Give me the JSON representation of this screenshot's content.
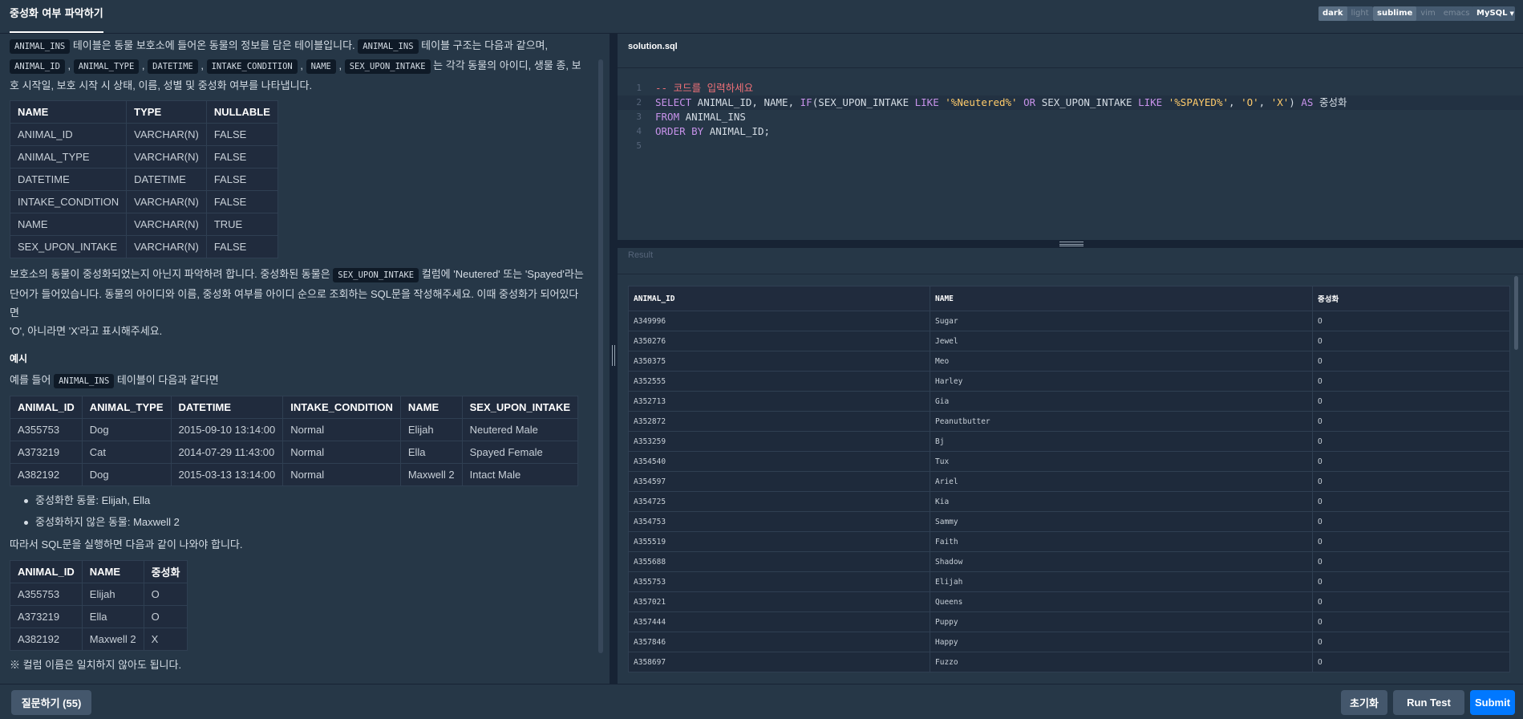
{
  "header": {
    "tab_title": "중성화 여부 파악하기",
    "theme": [
      "dark",
      "light"
    ],
    "keymap": [
      "sublime",
      "vim",
      "emacs"
    ],
    "language": "MySQL"
  },
  "problem": {
    "intro": {
      "p1_code": "ANIMAL_INS",
      "p1_text1": "테이블은 동물 보호소에 들어온 동물의 정보를 담은 테이블입니다.",
      "p1_code2": "ANIMAL_INS",
      "p1_text2": "테이블 구조는 다음과 같으며,",
      "cols": [
        "ANIMAL_ID",
        "ANIMAL_TYPE",
        "DATETIME",
        "INTAKE_CONDITION",
        "NAME",
        "SEX_UPON_INTAKE"
      ],
      "p1_text3": "는 각각 동물의 아이디, 생물 종, 보",
      "p1_text4": "호 시작일, 보호 시작 시 상태, 이름, 성별 및 중성화 여부를 나타냅니다."
    },
    "schema": {
      "headers": [
        "NAME",
        "TYPE",
        "NULLABLE"
      ],
      "rows": [
        [
          "ANIMAL_ID",
          "VARCHAR(N)",
          "FALSE"
        ],
        [
          "ANIMAL_TYPE",
          "VARCHAR(N)",
          "FALSE"
        ],
        [
          "DATETIME",
          "DATETIME",
          "FALSE"
        ],
        [
          "INTAKE_CONDITION",
          "VARCHAR(N)",
          "FALSE"
        ],
        [
          "NAME",
          "VARCHAR(N)",
          "TRUE"
        ],
        [
          "SEX_UPON_INTAKE",
          "VARCHAR(N)",
          "FALSE"
        ]
      ]
    },
    "task": {
      "t1": "보호소의 동물이 중성화되었는지 아닌지 파악하려 합니다. 중성화된 동물은",
      "t1_code": "SEX_UPON_INTAKE",
      "t2": "컬럼에 'Neutered' 또는 'Spayed'라는",
      "t3": "단어가 들어있습니다. 동물의 아이디와 이름, 중성화 여부를 아이디 순으로 조회하는 SQL문을 작성해주세요. 이때 중성화가 되어있다면",
      "t4": "'O', 아니라면 'X'라고 표시해주세요."
    },
    "example": {
      "heading": "예시",
      "lead1": "예를 들어",
      "lead_code": "ANIMAL_INS",
      "lead2": "테이블이 다음과 같다면",
      "headers": [
        "ANIMAL_ID",
        "ANIMAL_TYPE",
        "DATETIME",
        "INTAKE_CONDITION",
        "NAME",
        "SEX_UPON_INTAKE"
      ],
      "rows": [
        [
          "A355753",
          "Dog",
          "2015-09-10 13:14:00",
          "Normal",
          "Elijah",
          "Neutered Male"
        ],
        [
          "A373219",
          "Cat",
          "2014-07-29 11:43:00",
          "Normal",
          "Ella",
          "Spayed Female"
        ],
        [
          "A382192",
          "Dog",
          "2015-03-13 13:14:00",
          "Normal",
          "Maxwell 2",
          "Intact Male"
        ]
      ],
      "bullets": [
        "중성화한 동물: Elijah, Ella",
        "중성화하지 않은 동물: Maxwell 2"
      ],
      "after": "따라서 SQL문을 실행하면 다음과 같이 나와야 합니다.",
      "out_headers": [
        "ANIMAL_ID",
        "NAME",
        "중성화"
      ],
      "out_rows": [
        [
          "A355753",
          "Elijah",
          "O"
        ],
        [
          "A373219",
          "Ella",
          "O"
        ],
        [
          "A382192",
          "Maxwell 2",
          "X"
        ]
      ],
      "note": "※ 컬럼 이름은 일치하지 않아도 됩니다."
    }
  },
  "editor": {
    "file_name": "solution.sql",
    "line_numbers": [
      "1",
      "2",
      "3",
      "4",
      "5"
    ]
  },
  "result": {
    "label": "Result",
    "headers": [
      "ANIMAL_ID",
      "NAME",
      "중성화"
    ],
    "rows": [
      [
        "A349996",
        "Sugar",
        "O"
      ],
      [
        "A350276",
        "Jewel",
        "O"
      ],
      [
        "A350375",
        "Meo",
        "O"
      ],
      [
        "A352555",
        "Harley",
        "O"
      ],
      [
        "A352713",
        "Gia",
        "O"
      ],
      [
        "A352872",
        "Peanutbutter",
        "O"
      ],
      [
        "A353259",
        "Bj",
        "O"
      ],
      [
        "A354540",
        "Tux",
        "O"
      ],
      [
        "A354597",
        "Ariel",
        "O"
      ],
      [
        "A354725",
        "Kia",
        "O"
      ],
      [
        "A354753",
        "Sammy",
        "O"
      ],
      [
        "A355519",
        "Faith",
        "O"
      ],
      [
        "A355688",
        "Shadow",
        "O"
      ],
      [
        "A355753",
        "Elijah",
        "O"
      ],
      [
        "A357021",
        "Queens",
        "O"
      ],
      [
        "A357444",
        "Puppy",
        "O"
      ],
      [
        "A357846",
        "Happy",
        "O"
      ],
      [
        "A358697",
        "Fuzzo",
        "O"
      ]
    ]
  },
  "footer": {
    "question_button": "질문하기 (55)",
    "reset_button": "초기화",
    "run_button": "Run Test",
    "submit_button": "Submit"
  }
}
